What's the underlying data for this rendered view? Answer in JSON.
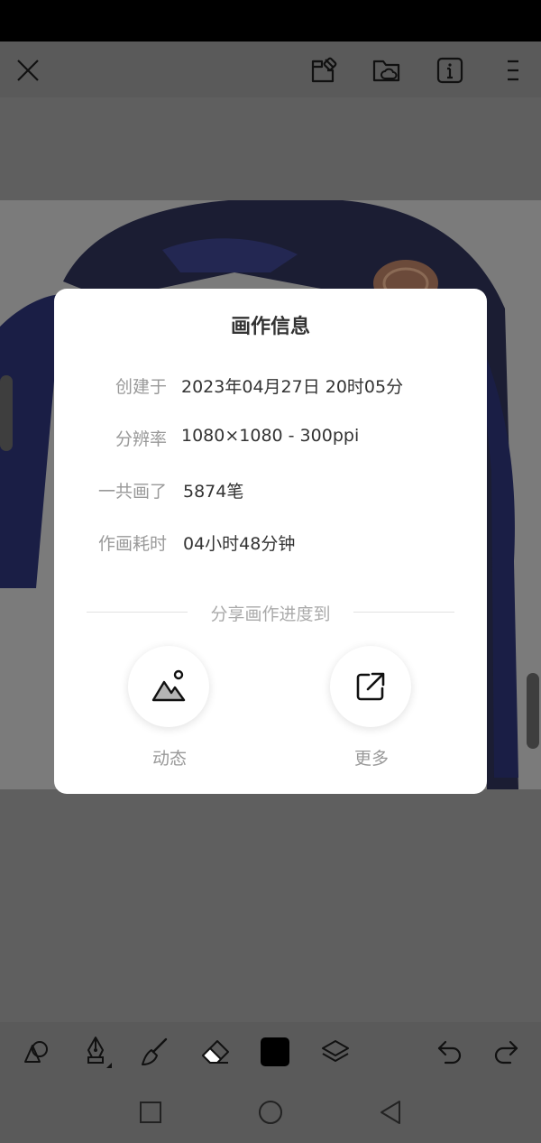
{
  "dialog": {
    "title": "画作信息",
    "rows": [
      {
        "label": "创建于",
        "value": "2023年04月27日 20时05分"
      },
      {
        "label": "分辨率",
        "value": "1080×1080 - 300ppi"
      },
      {
        "label": "一共画了",
        "value": "5874笔"
      },
      {
        "label": "作画耗时",
        "value": "04小时48分钟"
      }
    ],
    "share_title": "分享画作进度到",
    "share_items": [
      {
        "label": "动态",
        "icon": "image-icon"
      },
      {
        "label": "更多",
        "icon": "external-share-icon"
      }
    ]
  },
  "toolbar": {
    "top_icons": [
      "close-icon",
      "puzzle-icon",
      "folder-cloud-icon",
      "info-icon",
      "menu-icon"
    ],
    "bottom_icons": [
      "shape-icon",
      "pen-icon",
      "brush-icon",
      "eraser-icon",
      "color-swatch",
      "layers-icon",
      "undo-icon",
      "redo-icon"
    ]
  },
  "colors": {
    "dialog_bg": "#ffffff",
    "overlay": "#5a5a5a",
    "text_primary": "#333333",
    "text_secondary": "#999999"
  }
}
